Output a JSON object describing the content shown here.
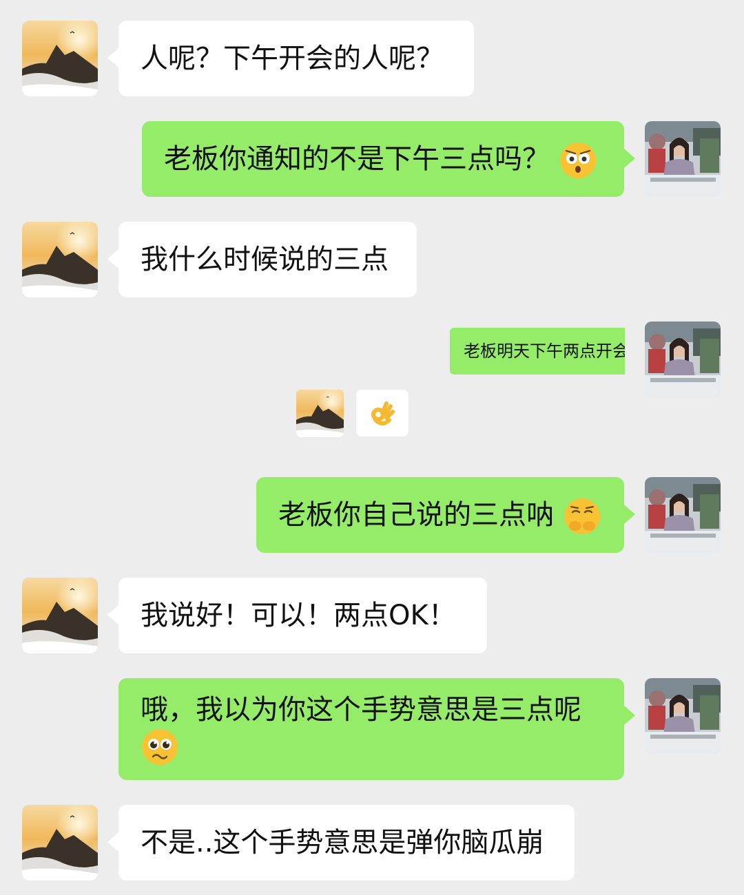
{
  "messages": [
    {
      "side": "in",
      "text": "人呢？下午开会的人呢？"
    },
    {
      "side": "out",
      "text": "老板你通知的不是下午三点吗？",
      "emoji": "flushed-face-icon"
    },
    {
      "side": "in",
      "text": "我什么时候说的三点"
    },
    {
      "side": "out",
      "text": "老板明天下午两点开会"
    },
    {
      "side": "in",
      "emoji": "ok-hand-icon"
    },
    {
      "side": "out",
      "text": "老板你自己说的三点呐",
      "emoji": "pleading-hand-over-mouth-icon"
    },
    {
      "side": "in",
      "text": "我说好！可以！两点OK！"
    },
    {
      "side": "out",
      "text": "哦，我以为你这个手势意思是三点呢",
      "emoji": "pleading-face-icon"
    },
    {
      "side": "in",
      "text": "不是..这个手势意思是弹你脑瓜崩"
    }
  ],
  "colors": {
    "background": "#ededed",
    "incoming": "#ffffff",
    "outgoing": "#95ec69"
  }
}
